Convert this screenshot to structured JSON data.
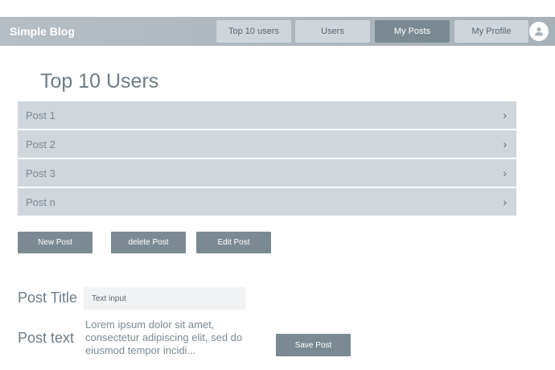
{
  "header": {
    "brand": "Simple Blog",
    "nav": [
      {
        "label": "Top 10 users"
      },
      {
        "label": "Users"
      },
      {
        "label": "My Posts"
      },
      {
        "label": "My Profile"
      }
    ],
    "active_nav": "My Posts",
    "avatar_icon": "user-icon"
  },
  "main": {
    "title": "Top 10 Users",
    "posts": [
      {
        "label": "Post 1",
        "chevron": "›"
      },
      {
        "label": "Post 2",
        "chevron": "›"
      },
      {
        "label": "Post 3",
        "chevron": "›"
      },
      {
        "label": "Post n",
        "chevron": "›"
      }
    ],
    "actions": {
      "new_post": "New Post",
      "delete_post": "delete Post",
      "edit_post": "Edit Post"
    },
    "form": {
      "title_label": "Post Title",
      "title_value": "Text input",
      "text_label": "Post text",
      "text_value": "Lorem ipsum dolor sit amet, consectetur adipiscing elit, sed do eiusmod tempor incidi...",
      "save_label": "Save Post"
    }
  },
  "colors": {
    "header_bg": "#b1b9c0",
    "button_dark": "#7b8a92",
    "button_light": "#ced6dc",
    "row_bg": "#cfd6dc",
    "text": "#6e7c86"
  }
}
